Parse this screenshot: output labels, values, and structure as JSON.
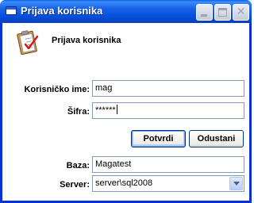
{
  "window": {
    "title": "Prijava korisnika",
    "title_icon": "window-icon",
    "controls": {
      "minimize": "minimize-icon",
      "maximize": "maximize-icon",
      "close": "close-icon"
    }
  },
  "header": {
    "icon": "clipboard-checklist-icon",
    "title": "Prijava korisnika"
  },
  "form": {
    "username": {
      "label": "Korisničko ime:",
      "value": "mag"
    },
    "password": {
      "label": "Šifra:",
      "value": "******"
    },
    "confirm_label": "Potvrdi",
    "cancel_label": "Odustani",
    "database": {
      "label": "Baza:",
      "value": "Magatest"
    },
    "server": {
      "label": "Server:",
      "value": "server\\sql2008"
    }
  },
  "colors": {
    "titlebar": "#0550dc",
    "button_border": "#003c74",
    "field_border": "#7f9db9"
  }
}
